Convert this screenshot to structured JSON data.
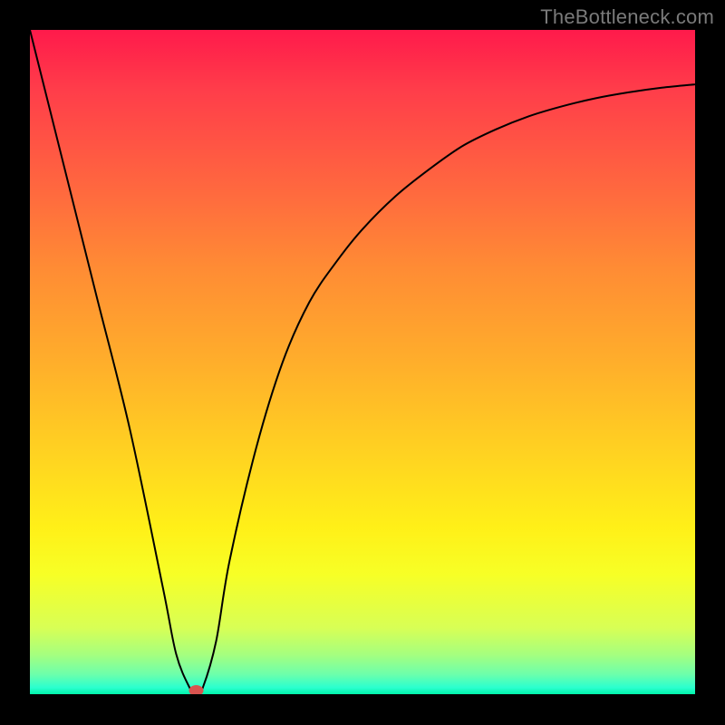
{
  "watermark": "TheBottleneck.com",
  "chart_data": {
    "type": "line",
    "title": "",
    "xlabel": "",
    "ylabel": "",
    "xlim": [
      0,
      100
    ],
    "ylim": [
      0,
      100
    ],
    "grid": false,
    "legend": false,
    "series": [
      {
        "name": "bottleneck-curve",
        "x": [
          0,
          5,
          10,
          15,
          20,
          22,
          24,
          25,
          26,
          28,
          30,
          34,
          38,
          42,
          46,
          50,
          55,
          60,
          65,
          70,
          75,
          80,
          85,
          90,
          95,
          100
        ],
        "y": [
          100,
          80,
          60,
          40,
          16,
          6,
          1,
          0,
          1,
          8,
          20,
          37,
          50,
          59,
          65,
          70,
          75,
          79,
          82.5,
          85,
          87,
          88.5,
          89.7,
          90.6,
          91.3,
          91.8
        ]
      }
    ],
    "marker": {
      "x": 25,
      "y": 0,
      "color": "#d9534f"
    }
  }
}
